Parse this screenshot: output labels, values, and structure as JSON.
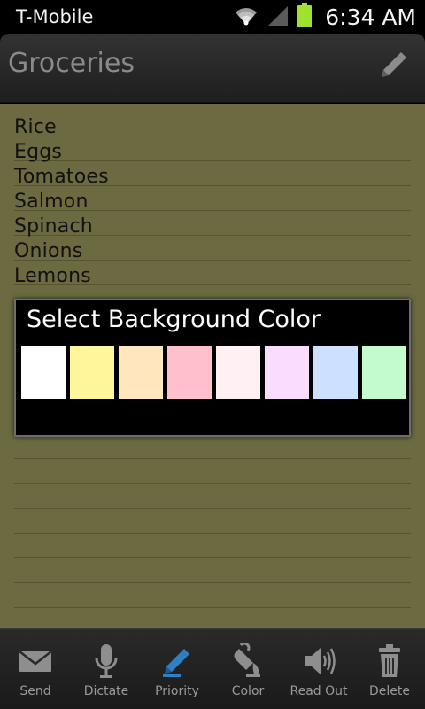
{
  "status_bar": {
    "carrier": "T-Mobile",
    "time": "6:34 AM"
  },
  "title_bar": {
    "title": "Groceries",
    "edit_icon": "pencil-icon"
  },
  "note": {
    "background_color": "#6b6a40",
    "items": [
      "Rice",
      "Eggs",
      "Tomatoes",
      "Salmon",
      "Spinach",
      "Onions",
      "Lemons"
    ]
  },
  "dialog": {
    "title": "Select Background Color",
    "swatches": [
      "#ffffff",
      "#fff59a",
      "#ffe6bd",
      "#ffc0cc",
      "#fff0f3",
      "#fadcff",
      "#cde0ff",
      "#c4fbcd"
    ]
  },
  "toolbar": {
    "active_color": "#2f7fc3",
    "items": [
      {
        "label": "Send",
        "icon": "envelope-icon"
      },
      {
        "label": "Dictate",
        "icon": "microphone-icon"
      },
      {
        "label": "Priority",
        "icon": "priority-pencil-icon"
      },
      {
        "label": "Color",
        "icon": "paint-bucket-icon"
      },
      {
        "label": "Read Out",
        "icon": "speaker-icon"
      },
      {
        "label": "Delete",
        "icon": "trash-icon"
      }
    ]
  }
}
